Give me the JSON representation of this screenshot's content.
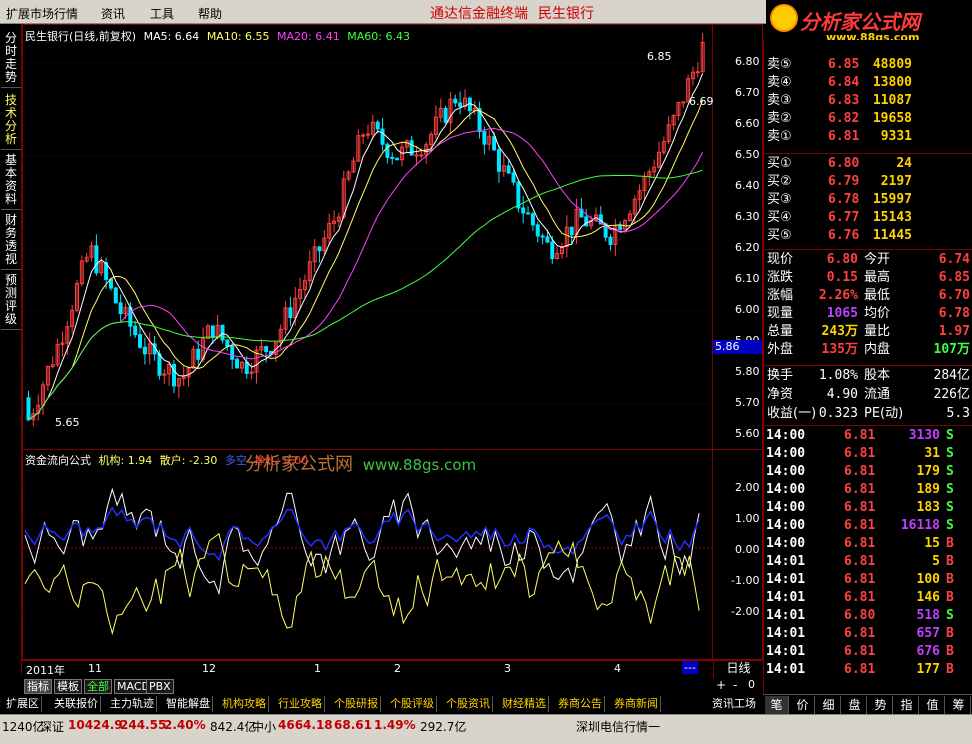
{
  "menu": {
    "items": [
      "扩展市场行情",
      "资讯",
      "工具",
      "帮助"
    ],
    "terminal": "通达信金融终端",
    "stock": "民生银行"
  },
  "logo": {
    "title": "分析家公式网",
    "url": "www.88gs.com"
  },
  "left_tabs": [
    "分时走势",
    "技术分析",
    "基本资料",
    "财务透视",
    "预测评级"
  ],
  "kline": {
    "header": {
      "name": "民生银行(日线,前复权)",
      "ma5": "MA5: 6.64",
      "ma10": "MA10: 6.55",
      "ma20": "MA20: 6.41",
      "ma60": "MA60: 6.43"
    },
    "price_labels": [
      "6.80",
      "6.70",
      "6.60",
      "6.50",
      "6.40",
      "6.30",
      "6.20",
      "6.10",
      "6.00",
      "5.90",
      "5.80",
      "5.70",
      "5.60"
    ],
    "hi_label": "6.85",
    "lo_label": "5.65",
    "cur_label": "6.69",
    "price_tag": "5.86",
    "colors": {
      "up": "#ff4040",
      "down": "#00e5ff",
      "ma5": "#ffffff",
      "ma10": "#ffff66",
      "ma20": "#ff40ff",
      "ma60": "#40ff40"
    }
  },
  "indicator": {
    "name": "资金流向公式",
    "jg": "机构: 1.94",
    "sh": "散户: -2.30",
    "duo": "多空",
    "zha": "挣扎: 0.00",
    "watermark": "分析家公式网",
    "watermark_url": "www.88gs.com",
    "scale": [
      "2.00",
      "1.00",
      "0.00",
      "-1.00",
      "-2.00"
    ]
  },
  "date_axis": {
    "labels": [
      "2011年",
      "11",
      "12",
      "1",
      "2",
      "3",
      "4"
    ],
    "end": "---"
  },
  "period": "日线",
  "toolbar2": [
    "指标",
    "模板",
    "全部",
    "MACD",
    "PBX"
  ],
  "toolbar3": [
    "扩展区",
    "关联报价",
    "主力轨迹",
    "智能解盘",
    "机构攻略",
    "行业攻略",
    "个股研报",
    "个股评级",
    "个股资讯",
    "财经精选",
    "券商公告",
    "券商新闻"
  ],
  "quote": {
    "asks": [
      {
        "l": "卖⑤",
        "p": "6.85",
        "v": "48809"
      },
      {
        "l": "卖④",
        "p": "6.84",
        "v": "13800"
      },
      {
        "l": "卖③",
        "p": "6.83",
        "v": "11087"
      },
      {
        "l": "卖②",
        "p": "6.82",
        "v": "19658"
      },
      {
        "l": "卖①",
        "p": "6.81",
        "v": "9331"
      }
    ],
    "bids": [
      {
        "l": "买①",
        "p": "6.80",
        "v": "24"
      },
      {
        "l": "买②",
        "p": "6.79",
        "v": "2197"
      },
      {
        "l": "买③",
        "p": "6.78",
        "v": "15997"
      },
      {
        "l": "买④",
        "p": "6.77",
        "v": "15143"
      },
      {
        "l": "买⑤",
        "p": "6.76",
        "v": "11445"
      }
    ],
    "stats1": [
      {
        "k1": "现价",
        "v1": "6.80",
        "c1": "#ff4040",
        "k2": "今开",
        "v2": "6.74",
        "c2": "#ff4040"
      },
      {
        "k1": "涨跌",
        "v1": "0.15",
        "c1": "#ff4040",
        "k2": "最高",
        "v2": "6.85",
        "c2": "#ff4040"
      },
      {
        "k1": "涨幅",
        "v1": "2.26%",
        "c1": "#ff4040",
        "k2": "最低",
        "v2": "6.70",
        "c2": "#ff4040"
      },
      {
        "k1": "现量",
        "v1": "1065",
        "c1": "#c040ff",
        "k2": "均价",
        "v2": "6.78",
        "c2": "#ff4040"
      },
      {
        "k1": "总量",
        "v1": "243万",
        "c1": "#ffd200",
        "k2": "量比",
        "v2": "1.97",
        "c2": "#ff4040"
      },
      {
        "k1": "外盘",
        "v1": "135万",
        "c1": "#ff4040",
        "k2": "内盘",
        "v2": "107万",
        "c2": "#40ff40"
      }
    ],
    "stats2": [
      {
        "k1": "换手",
        "v1": "1.08%",
        "k2": "股本",
        "v2": "284亿"
      },
      {
        "k1": "净资",
        "v1": "4.90",
        "k2": "流通",
        "v2": "226亿"
      },
      {
        "k1": "收益(一)",
        "v1": "0.323",
        "k2": "PE(动)",
        "v2": "5.3"
      }
    ],
    "ticks": [
      {
        "t": "14:00",
        "p": "6.81",
        "v": "3130",
        "d": "S",
        "vc": "#c040ff"
      },
      {
        "t": "14:00",
        "p": "6.81",
        "v": "31",
        "d": "S",
        "vc": "#ffd200"
      },
      {
        "t": "14:00",
        "p": "6.81",
        "v": "179",
        "d": "S",
        "vc": "#ffd200"
      },
      {
        "t": "14:00",
        "p": "6.81",
        "v": "189",
        "d": "S",
        "vc": "#ffd200"
      },
      {
        "t": "14:00",
        "p": "6.81",
        "v": "183",
        "d": "S",
        "vc": "#ffd200"
      },
      {
        "t": "14:00",
        "p": "6.81",
        "v": "16118",
        "d": "S",
        "vc": "#c040ff"
      },
      {
        "t": "14:00",
        "p": "6.81",
        "v": "15",
        "d": "B",
        "vc": "#ffd200"
      },
      {
        "t": "14:01",
        "p": "6.81",
        "v": "5",
        "d": "B",
        "vc": "#ffd200"
      },
      {
        "t": "14:01",
        "p": "6.81",
        "v": "100",
        "d": "B",
        "vc": "#ffd200"
      },
      {
        "t": "14:01",
        "p": "6.81",
        "v": "146",
        "d": "B",
        "vc": "#ffd200"
      },
      {
        "t": "14:01",
        "p": "6.80",
        "v": "518",
        "d": "S",
        "vc": "#c040ff"
      },
      {
        "t": "14:01",
        "p": "6.81",
        "v": "657",
        "d": "B",
        "vc": "#c040ff"
      },
      {
        "t": "14:01",
        "p": "6.81",
        "v": "676",
        "d": "B",
        "vc": "#c040ff"
      },
      {
        "t": "14:01",
        "p": "6.81",
        "v": "177",
        "d": "B",
        "vc": "#ffd200"
      }
    ]
  },
  "quote_tabs": [
    "笔",
    "价",
    "细",
    "盘",
    "势",
    "指",
    "值",
    "筹"
  ],
  "status": {
    "a": "1240亿",
    "sz": "深证",
    "szv": "10424.9",
    "szc": "244.55",
    "szp": "2.40%",
    "szamt": "842.4亿",
    "zx": "中小",
    "zxv": "4664.18",
    "zxc": "68.61",
    "zxp": "1.49%",
    "zxamt": "292.7亿",
    "info": "深圳电信行情一",
    "zixun": "资讯工场"
  }
}
